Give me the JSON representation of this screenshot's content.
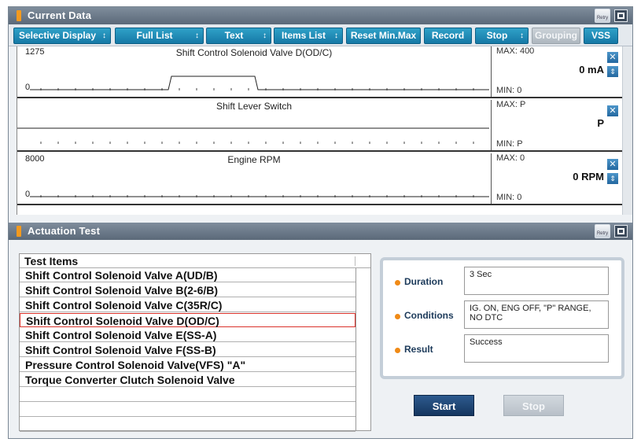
{
  "current_data": {
    "title": "Current Data",
    "retry_label": "Retry",
    "toolbar": [
      {
        "label": "Selective Display",
        "dropdown": true,
        "enabled": true
      },
      {
        "label": "Full List",
        "dropdown": true,
        "enabled": true
      },
      {
        "label": "Text",
        "dropdown": true,
        "enabled": true
      },
      {
        "label": "Items List",
        "dropdown": true,
        "enabled": true
      },
      {
        "label": "Reset Min.Max",
        "dropdown": false,
        "enabled": true
      },
      {
        "label": "Record",
        "dropdown": false,
        "enabled": true
      },
      {
        "label": "Stop",
        "dropdown": true,
        "enabled": true
      },
      {
        "label": "Grouping",
        "dropdown": false,
        "enabled": false
      },
      {
        "label": "VSS",
        "dropdown": false,
        "enabled": true
      }
    ],
    "graphs": [
      {
        "name": "Shift Control Solenoid Valve D(OD/C)",
        "scale_top": "1275",
        "scale_bottom": "0",
        "max": "MAX: 400",
        "min": "MIN: 0",
        "value": "0 mA",
        "signal": "pulse"
      },
      {
        "name": "Shift Lever Switch",
        "scale_top": "",
        "scale_bottom": "",
        "max": "MAX: P",
        "min": "MIN: P",
        "value": "P",
        "signal": "flat"
      },
      {
        "name": "Engine RPM",
        "scale_top": "8000",
        "scale_bottom": "0",
        "max": "MAX: 0",
        "min": "MIN: 0",
        "value": "0 RPM",
        "signal": "zero"
      }
    ]
  },
  "actuation_test": {
    "title": "Actuation Test",
    "retry_label": "Retry",
    "list_header": "Test Items",
    "items": [
      "Shift Control Solenoid Valve A(UD/B)",
      "Shift Control Solenoid Valve B(2-6/B)",
      "Shift Control Solenoid Valve C(35R/C)",
      "Shift Control Solenoid Valve D(OD/C)",
      "Shift Control Solenoid Valve E(SS-A)",
      "Shift Control Solenoid Valve F(SS-B)",
      "Pressure Control Solenoid Valve(VFS) \"A\"",
      "Torque Converter Clutch Solenoid Valve",
      "",
      "",
      ""
    ],
    "selected_index": 3,
    "info": {
      "duration_label": "Duration",
      "duration_value": "3 Sec",
      "conditions_label": "Conditions",
      "conditions_value": "IG. ON, ENG OFF, \"P\" RANGE, NO DTC",
      "result_label": "Result",
      "result_value": "Success"
    },
    "start_label": "Start",
    "stop_label": "Stop"
  },
  "colors": {
    "accent": "#1a86b6",
    "title_bar": "#6b7988",
    "marker": "#f39a1f",
    "selection": "#d9322b"
  }
}
